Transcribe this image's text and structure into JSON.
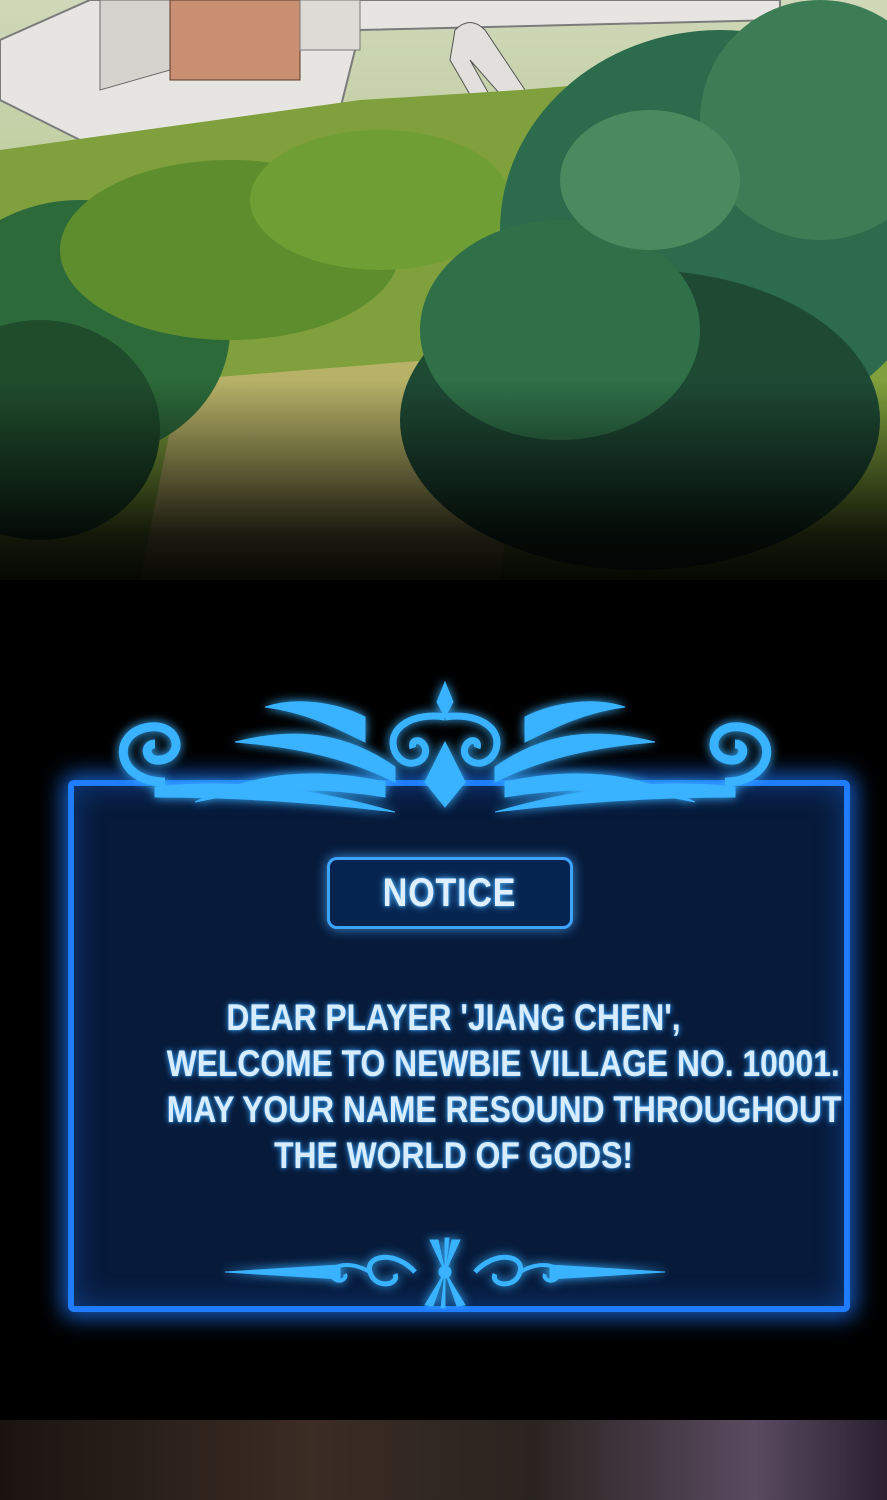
{
  "scene": {
    "icon": "castle-forest-illustration"
  },
  "notice": {
    "title": "NOTICE",
    "lines": [
      "DEAR PLAYER 'JIANG CHEN',",
      "WELCOME TO NEWBIE VILLAGE NO. 10001.",
      "MAY YOUR NAME RESOUND THROUGHOUT",
      "THE WORLD OF GODS!"
    ]
  },
  "colors": {
    "panel_bg": "#071a3a",
    "panel_border": "#1f7cff",
    "text_glow": "#3aa5ff",
    "ornament": "#3ab0ff"
  }
}
